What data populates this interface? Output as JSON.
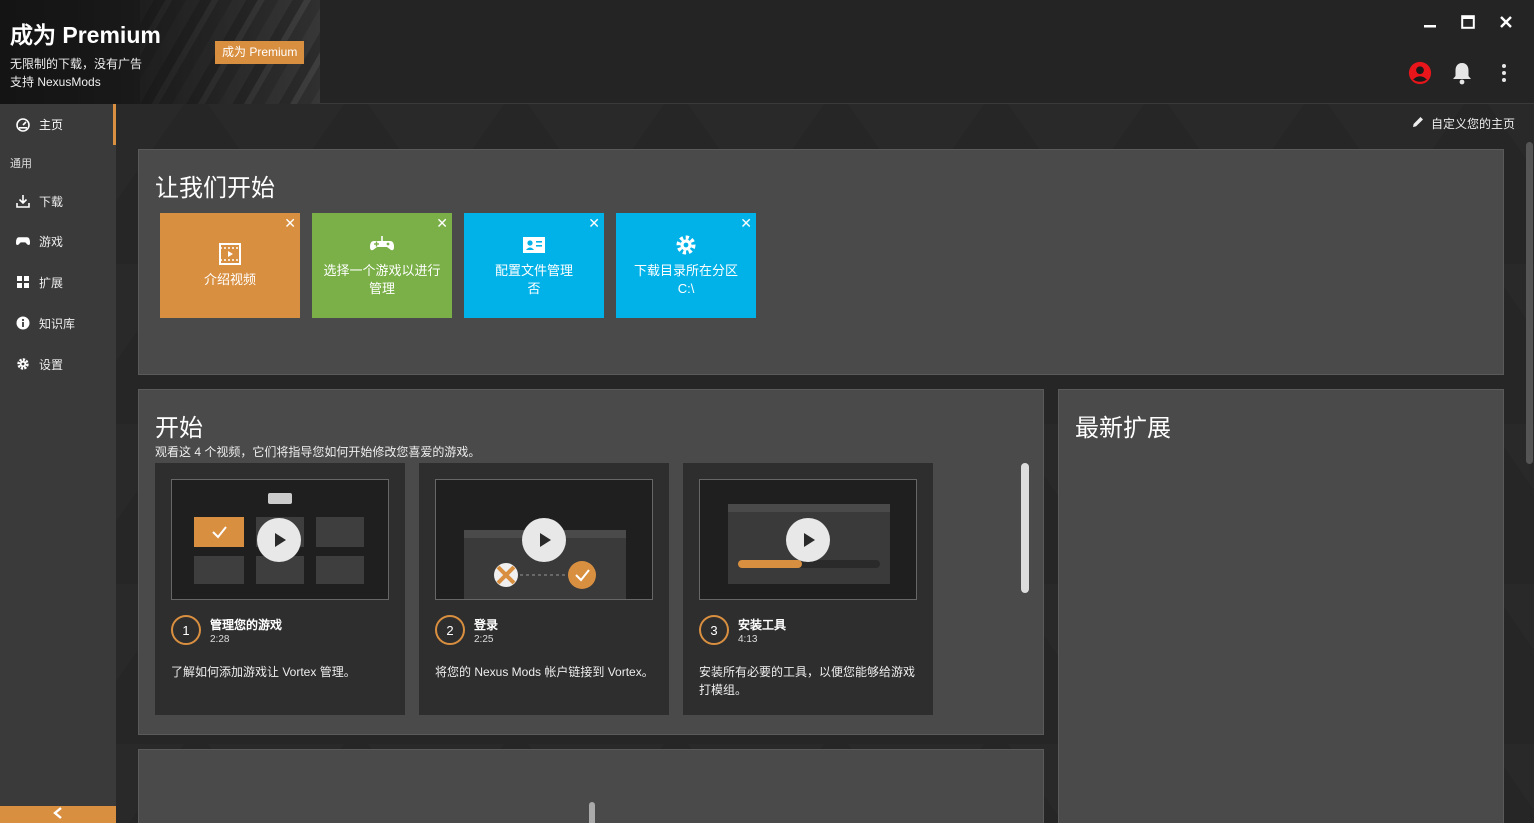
{
  "banner": {
    "title": "成为 Premium",
    "line1": "无限制的下载，没有广告",
    "line2": "支持 NexusMods",
    "button_label": "成为 Premium"
  },
  "window_controls": {
    "minimize_icon": "minimize-icon",
    "maximize_icon": "maximize-icon",
    "close_icon": "close-icon"
  },
  "top_icons": [
    "profile-icon",
    "bell-icon",
    "more-vertical-icon"
  ],
  "sidebar": {
    "home_label": "主页",
    "section_label": "通用",
    "items": [
      {
        "label": "下载",
        "icon": "download-icon"
      },
      {
        "label": "游戏",
        "icon": "gamepad-icon"
      },
      {
        "label": "扩展",
        "icon": "extensions-icon"
      },
      {
        "label": "知识库",
        "icon": "info-icon"
      },
      {
        "label": "设置",
        "icon": "gear-icon"
      }
    ]
  },
  "main": {
    "customize_label": "自定义您的主页",
    "get_started": {
      "title": "让我们开始",
      "tiles": [
        {
          "line1": "介绍视频",
          "line2": "",
          "color": "#d98f40",
          "icon": "film-icon"
        },
        {
          "line1": "选择一个游戏以进行管理",
          "line2": "",
          "color": "#7ab047",
          "icon": "gamepad-icon"
        },
        {
          "line1": "配置文件管理",
          "line2": "否",
          "color": "#00b2e8",
          "icon": "profile-card-icon"
        },
        {
          "line1": "下载目录所在分区",
          "line2": "C:\\",
          "color": "#00b2e8",
          "icon": "gear-icon"
        }
      ]
    },
    "start": {
      "title": "开始",
      "subtitle": "观看这 4 个视频，它们将指导您如何开始修改您喜爱的游戏。",
      "videos": [
        {
          "num": "1",
          "title": "管理您的游戏",
          "duration": "2:28",
          "desc": "了解如何添加游戏让 Vortex 管理。"
        },
        {
          "num": "2",
          "title": "登录",
          "duration": "2:25",
          "desc": "将您的 Nexus Mods 帐户链接到 Vortex。"
        },
        {
          "num": "3",
          "title": "安装工具",
          "duration": "4:13",
          "desc": "安装所有必要的工具，以便您能够给游戏打模组。"
        }
      ]
    },
    "latest_extensions": {
      "title": "最新扩展"
    }
  },
  "colors": {
    "accent": "#d98f40",
    "green": "#7ab047",
    "cyan": "#00b2e8",
    "profile_red": "#e8161b"
  }
}
